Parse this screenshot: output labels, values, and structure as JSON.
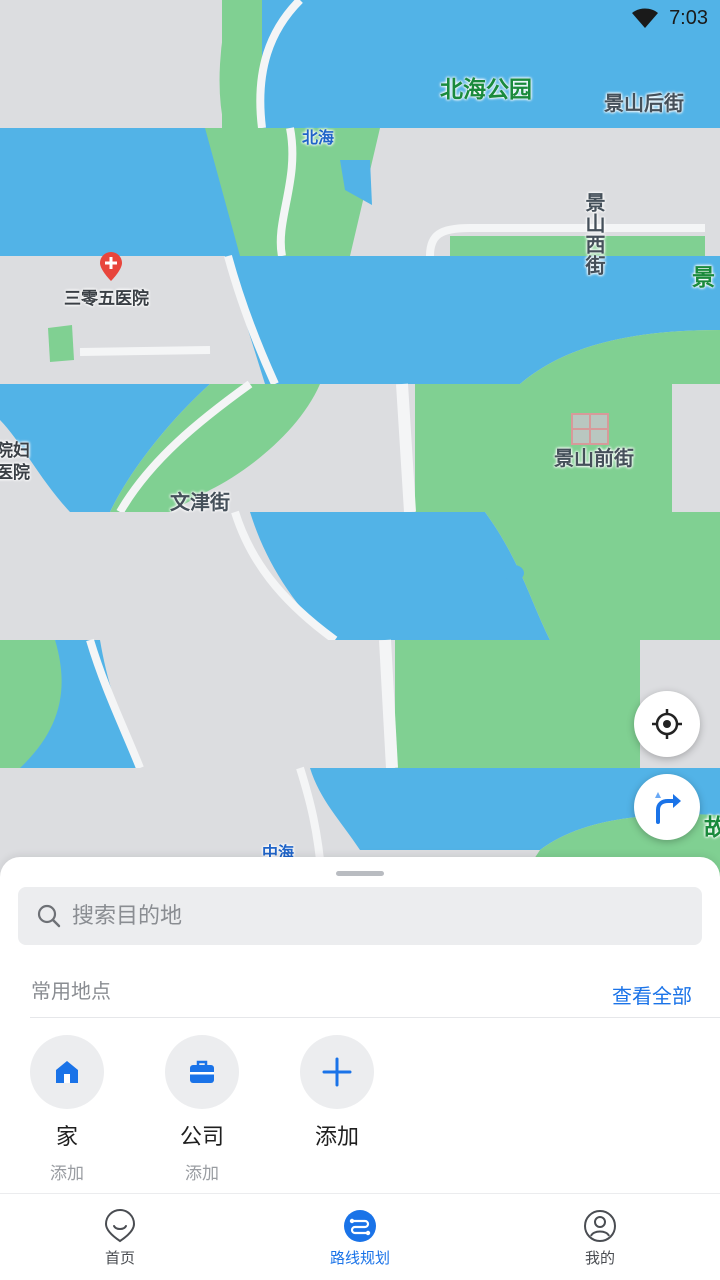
{
  "status_bar": {
    "time": "7:03",
    "wifi_icon": "wifi-icon"
  },
  "map": {
    "labels": {
      "beihai_park": "北海公园",
      "jingshan_hou_jie": "景山后街",
      "beihai": "北海",
      "jingshan_xi_jie": "景山西街",
      "jing_edge": "景",
      "hospital_305": "三零五医院",
      "hospital_partial": "院妇\n医院",
      "jingshan_qian_jie": "景山前街",
      "wenjin_jie": "文津街",
      "zhonghai": "中海",
      "gu_edge": "故"
    },
    "colors": {
      "water": "#52b3e7",
      "park": "#80d092",
      "land": "#dcdde0",
      "road": "#f4f5f6"
    }
  },
  "buttons": {
    "locate_icon": "locate-crosshair-icon",
    "route_icon": "route-turn-icon"
  },
  "sheet": {
    "search_placeholder": "搜索目的地",
    "favorites_title": "常用地点",
    "view_all": "查看全部",
    "places": [
      {
        "name": "家",
        "sub": "添加",
        "icon": "home-icon"
      },
      {
        "name": "公司",
        "sub": "添加",
        "icon": "briefcase-icon"
      },
      {
        "name": "添加",
        "sub": "",
        "icon": "plus-icon"
      }
    ]
  },
  "nav": {
    "items": [
      {
        "label": "首页",
        "icon": "home-smile-icon",
        "active": false
      },
      {
        "label": "路线规划",
        "icon": "route-plan-icon",
        "active": true
      },
      {
        "label": "我的",
        "icon": "profile-icon",
        "active": false
      }
    ]
  }
}
